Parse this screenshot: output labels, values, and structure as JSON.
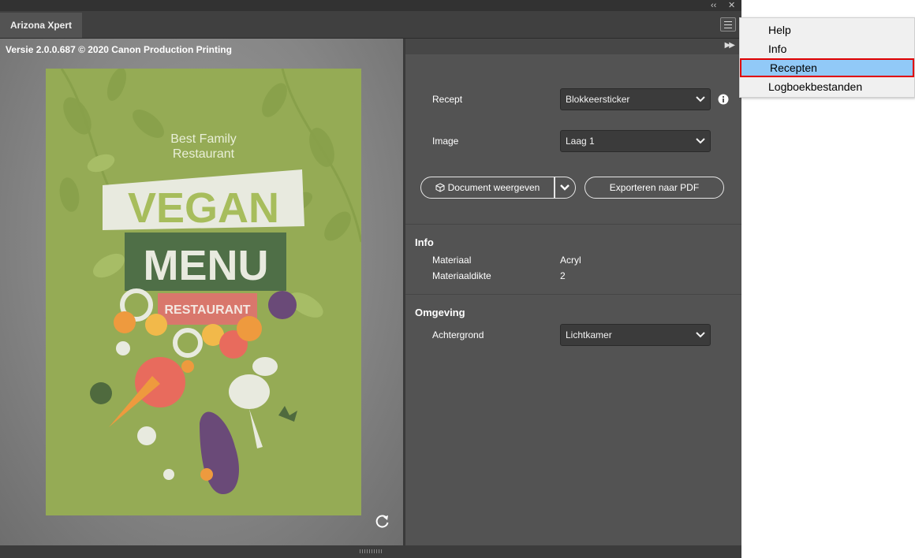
{
  "panel": {
    "tab_label": "Arizona Xpert",
    "version_text": "Versie 2.0.0.687 © 2020 Canon Production Printing",
    "window_controls": {
      "collapse": "‹‹",
      "close": "✕"
    }
  },
  "poster": {
    "line1": "Best Family",
    "line2": "Restaurant",
    "word1": "VEGAN",
    "word2": "MENU",
    "word3": "RESTAURANT",
    "colors": {
      "background": "#95ab55",
      "menu_band": "#4f6f47",
      "restaurant_band": "#d9776c"
    }
  },
  "settings": {
    "recept_label": "Recept",
    "recept_value": "Blokkeersticker",
    "image_label": "Image",
    "image_value": "Laag 1",
    "document_button": "Document weergeven",
    "export_button": "Exporteren naar PDF"
  },
  "info": {
    "title": "Info",
    "rows": [
      {
        "label": "Materiaal",
        "value": "Acryl"
      },
      {
        "label": "Materiaaldikte",
        "value": "2"
      }
    ]
  },
  "environment": {
    "title": "Omgeving",
    "background_label": "Achtergrond",
    "background_value": "Lichtkamer"
  },
  "context_menu": {
    "items": [
      {
        "label": "Help"
      },
      {
        "label": "Info"
      },
      {
        "label": "Recepten",
        "selected": true
      },
      {
        "label": "Logboekbestanden"
      }
    ]
  },
  "icons": [
    "collapse-panel-icon",
    "close-icon",
    "hamburger-menu-icon",
    "expand-panel-icon",
    "chevron-down-icon",
    "info-icon",
    "cube-icon",
    "reset-icon"
  ]
}
